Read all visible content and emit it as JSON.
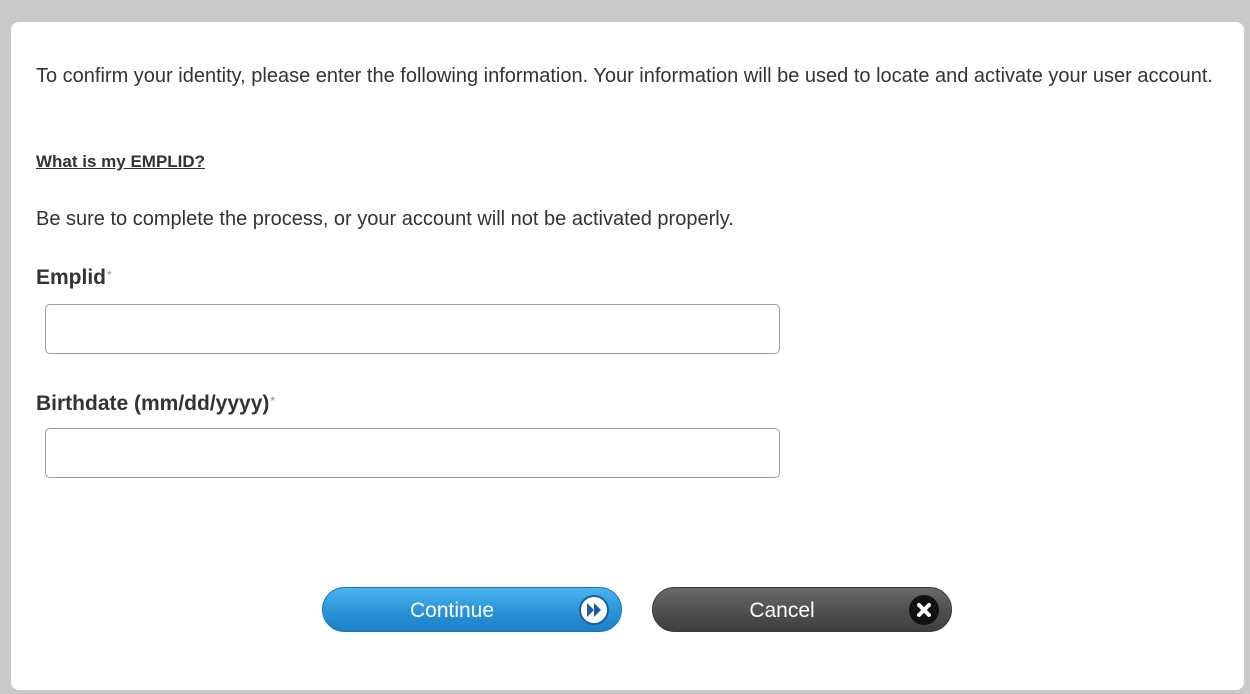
{
  "intro_text": "To confirm your identity, please enter the following information. Your information will be used to locate and activate your user account.",
  "help_link": "What is my EMPLID?",
  "note_text": "Be sure to complete the process, or your account will not be activated properly.",
  "fields": {
    "emplid": {
      "label": "Emplid",
      "required_marker": "*",
      "value": ""
    },
    "birthdate": {
      "label": "Birthdate (mm/dd/yyyy)",
      "required_marker": "*",
      "value": ""
    }
  },
  "buttons": {
    "continue": {
      "label": "Continue",
      "icon": "fast-forward-icon",
      "color": "#2a93d8"
    },
    "cancel": {
      "label": "Cancel",
      "icon": "close-icon",
      "color": "#4f4f4f"
    }
  }
}
